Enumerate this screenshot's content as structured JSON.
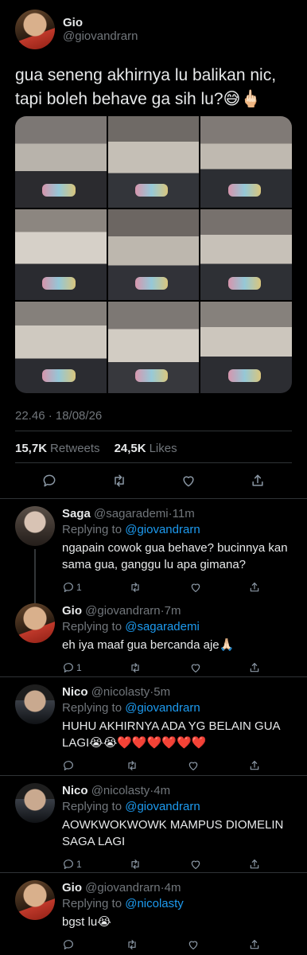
{
  "tweet": {
    "name": "Gio",
    "handle": "@giovandrarn",
    "text": "gua seneng akhirnya lu balikan nic, tapi boleh behave ga sih lu?😅🖕🏻",
    "timestamp": "22.46 · 18/08/26",
    "retweets_count": "15,7K",
    "retweets_label": "Retweets",
    "likes_count": "24,5K",
    "likes_label": "Likes"
  },
  "replies": [
    {
      "name": "Saga",
      "handle": "@sagarademi",
      "time": "11m",
      "replying_prefix": "Replying to ",
      "replying_to": "@giovandrarn",
      "text": "ngapain cowok gua behave? bucinnya kan sama gua, ganggu lu apa gimana?",
      "reply_count": "1"
    },
    {
      "name": "Gio",
      "handle": "@giovandrarn",
      "time": "7m",
      "replying_prefix": "Replying to ",
      "replying_to": "@sagarademi",
      "text": "eh iya maaf gua bercanda aje🙏🏻",
      "reply_count": "1"
    },
    {
      "name": "Nico",
      "handle": "@nicolasty",
      "time": "5m",
      "replying_prefix": "Replying to ",
      "replying_to": "@giovandrarn",
      "text": "HUHU AKHIRNYA ADA YG BELAIN GUA LAGI😭😭❤️❤️❤️❤️❤️❤️",
      "reply_count": ""
    },
    {
      "name": "Nico",
      "handle": "@nicolasty",
      "time": "4m",
      "replying_prefix": "Replying to ",
      "replying_to": "@giovandrarn",
      "text": "AOWKWOKWOWK MAMPUS DIOMELIN SAGA LAGI",
      "reply_count": "1"
    },
    {
      "name": "Gio",
      "handle": "@giovandrarn",
      "time": "4m",
      "replying_prefix": "Replying to ",
      "replying_to": "@nicolasty",
      "text": "bgst lu😭",
      "reply_count": ""
    }
  ],
  "icons": {
    "reply": "reply-icon",
    "retweet": "retweet-icon",
    "like": "heart-icon",
    "share": "share-icon"
  },
  "colors": {
    "background": "#000000",
    "mention": "#1d9bf0",
    "muted": "#71767b"
  }
}
